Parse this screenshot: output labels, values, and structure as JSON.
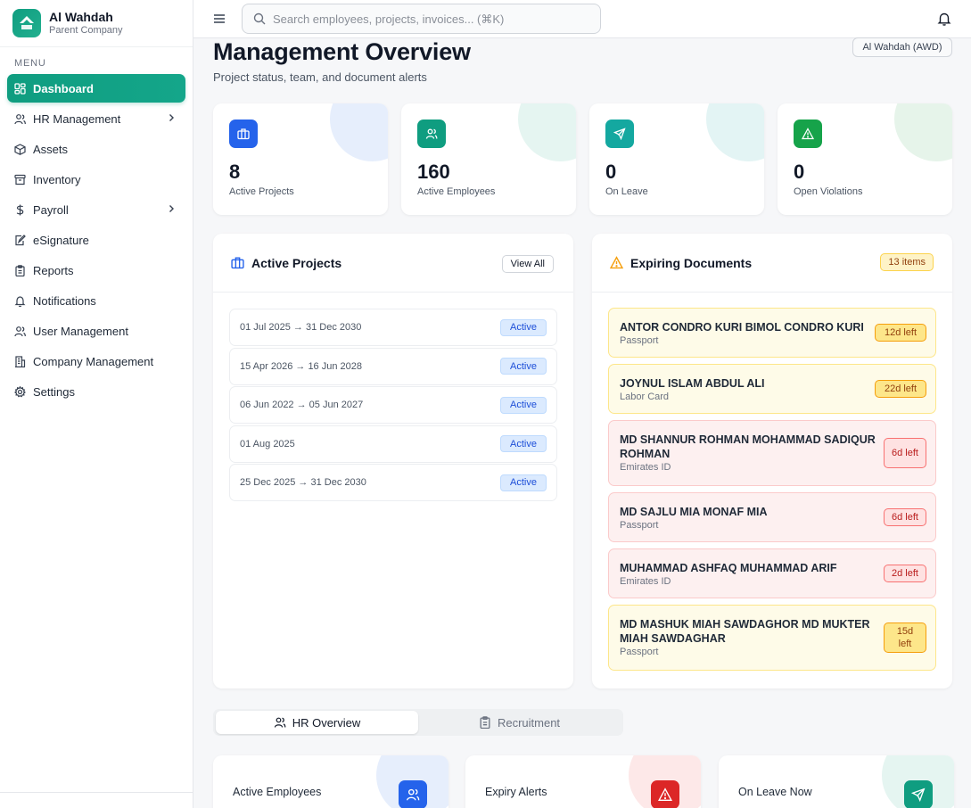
{
  "brand": {
    "name": "Al Wahdah",
    "subtitle": "Parent Company"
  },
  "sidebar": {
    "caption": "MENU",
    "items": [
      {
        "label": "Dashboard",
        "icon": "dashboard-icon",
        "active": true
      },
      {
        "label": "HR Management",
        "icon": "users-icon",
        "has_children": true
      },
      {
        "label": "Assets",
        "icon": "box-icon"
      },
      {
        "label": "Inventory",
        "icon": "archive-icon"
      },
      {
        "label": "Payroll",
        "icon": "dollar-icon",
        "has_children": true
      },
      {
        "label": "eSignature",
        "icon": "signature-icon"
      },
      {
        "label": "Reports",
        "icon": "clipboard-icon"
      },
      {
        "label": "Notifications",
        "icon": "bell-icon"
      },
      {
        "label": "User Management",
        "icon": "user-group-icon"
      },
      {
        "label": "Company Management",
        "icon": "building-icon"
      },
      {
        "label": "Settings",
        "icon": "gear-icon"
      }
    ]
  },
  "header": {
    "search_placeholder": "Search employees, projects, invoices... (⌘K)"
  },
  "page": {
    "title": "Management Overview",
    "subtitle": "Project status, team, and document alerts",
    "company_selector": "Al Wahdah (AWD)"
  },
  "stats": [
    {
      "value": "8",
      "label": "Active Projects",
      "color": "#2563eb",
      "icon": "briefcase-icon"
    },
    {
      "value": "160",
      "label": "Active Employees",
      "color": "#0f9d80",
      "icon": "users-icon"
    },
    {
      "value": "0",
      "label": "On Leave",
      "color": "#14a8a0",
      "icon": "plane-icon"
    },
    {
      "value": "0",
      "label": "Open Violations",
      "color": "#16a34a",
      "icon": "alert-icon"
    }
  ],
  "projects": {
    "title": "Active Projects",
    "view_all": "View All",
    "rows": [
      {
        "dates": "01 Jul 2025 → 31 Dec 2030",
        "status": "Active"
      },
      {
        "dates": "15 Apr 2026 → 16 Jun 2028",
        "status": "Active"
      },
      {
        "dates": "06 Jun 2022 → 05 Jun 2027",
        "status": "Active"
      },
      {
        "dates": "01 Aug 2025",
        "status": "Active"
      },
      {
        "dates": "25 Dec 2025 → 31 Dec 2030",
        "status": "Active"
      }
    ]
  },
  "documents": {
    "title": "Expiring Documents",
    "count": "13 items",
    "items": [
      {
        "name": "ANTOR CONDRO KURI BIMOL CONDRO KURI",
        "type": "Passport",
        "days": "12d left",
        "level": "warn"
      },
      {
        "name": "JOYNUL ISLAM ABDUL ALI",
        "type": "Labor Card",
        "days": "22d left",
        "level": "warn"
      },
      {
        "name": "MD SHANNUR ROHMAN MOHAMMAD SADIQUR ROHMAN",
        "type": "Emirates ID",
        "days": "6d left",
        "level": "danger"
      },
      {
        "name": "MD SAJLU MIA MONAF MIA",
        "type": "Passport",
        "days": "6d left",
        "level": "danger"
      },
      {
        "name": "MUHAMMAD ASHFAQ MUHAMMAD ARIF",
        "type": "Emirates ID",
        "days": "2d left",
        "level": "danger"
      },
      {
        "name": "MD MASHUK MIAH SAWDAGHOR MD MUKTER MIAH SAWDAGHAR",
        "type": "Passport",
        "days": "15d left",
        "level": "warn"
      }
    ]
  },
  "tabs": [
    {
      "label": "HR Overview",
      "active": true
    },
    {
      "label": "Recruitment",
      "active": false
    }
  ],
  "bottom_cards": [
    {
      "label": "Active Employees",
      "color": "#2563eb",
      "icon": "users-icon"
    },
    {
      "label": "Expiry Alerts",
      "color": "#dc2626",
      "icon": "alert-icon"
    },
    {
      "label": "On Leave Now",
      "color": "#0f9d80",
      "icon": "plane-icon"
    }
  ],
  "colors": {
    "accent": "#0f9d80",
    "blue": "#2563eb",
    "warning": "#f59e0b",
    "danger": "#dc2626"
  }
}
